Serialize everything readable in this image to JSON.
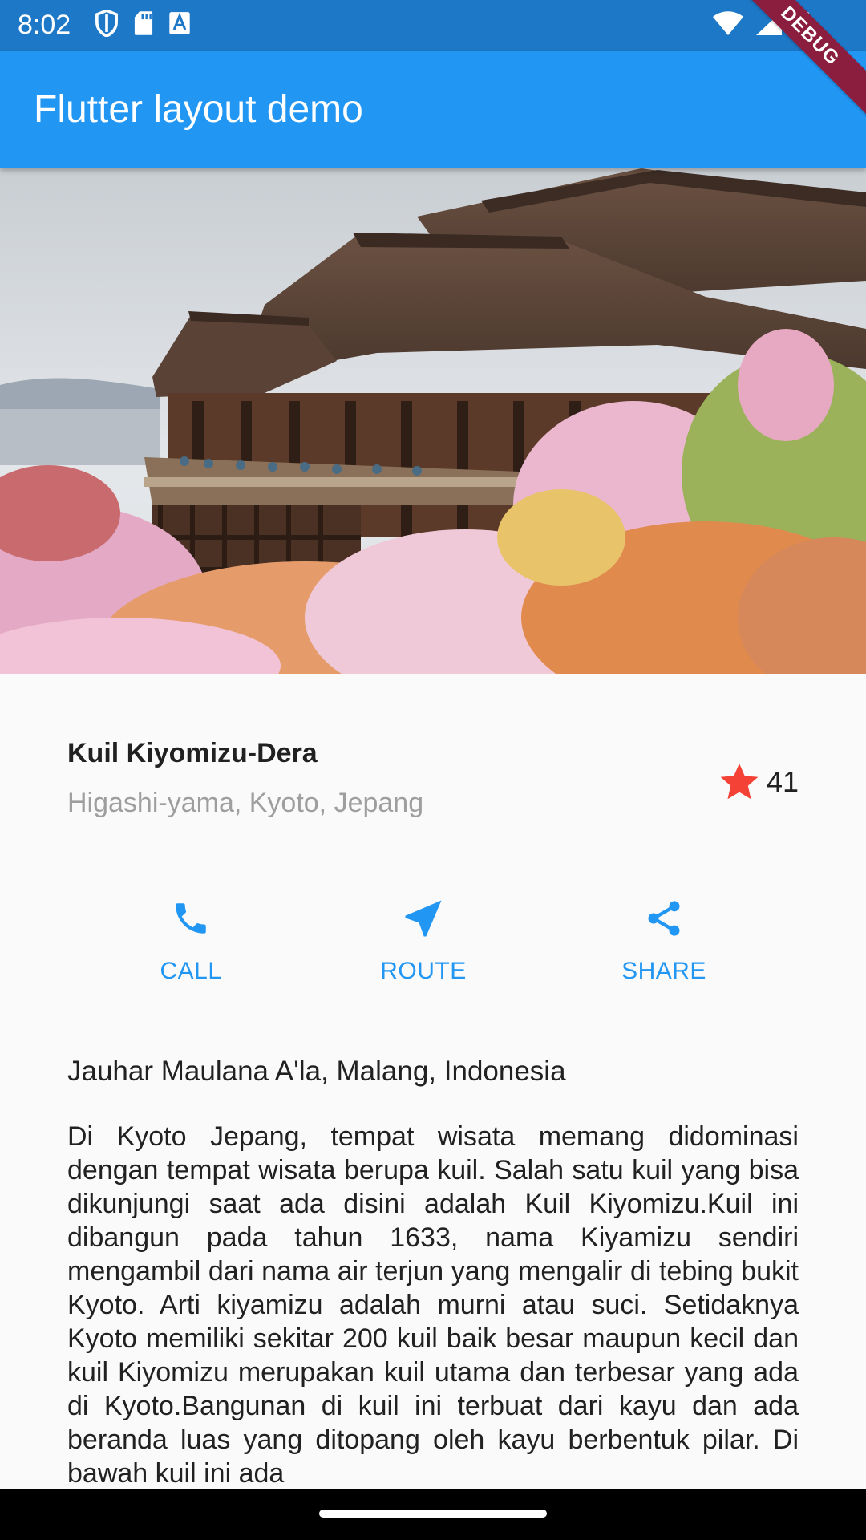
{
  "status_bar": {
    "time": "8:02",
    "left_icons": [
      "shield-icon",
      "sd-card-icon",
      "text-box-icon"
    ],
    "right_icons": [
      "wifi-icon",
      "signal-icon",
      "battery-icon"
    ]
  },
  "app_bar": {
    "title": "Flutter layout demo"
  },
  "debug_banner": "DEBUG",
  "place": {
    "name": "Kuil Kiyomizu-Dera",
    "location": "Higashi-yama, Kyoto, Jepang",
    "rating_count": "41",
    "star_color": "#F44336"
  },
  "actions": [
    {
      "label": "CALL",
      "icon": "phone-icon"
    },
    {
      "label": "ROUTE",
      "icon": "navigation-icon"
    },
    {
      "label": "SHARE",
      "icon": "share-icon"
    }
  ],
  "accent_color": "#2196F3",
  "author": "Jauhar Maulana A'la, Malang, Indonesia",
  "description": "Di Kyoto Jepang, tempat wisata memang didominasi dengan tempat wisata berupa kuil. Salah satu kuil yang bisa dikunjungi saat ada disini adalah Kuil Kiyomizu.Kuil ini dibangun pada tahun 1633, nama Kiyamizu sendiri mengambil dari nama air terjun yang mengalir di tebing bukit Kyoto. Arti kiyamizu adalah murni atau suci. Setidaknya Kyoto memiliki sekitar 200 kuil baik besar maupun kecil dan kuil Kiyomizu merupakan kuil utama dan terbesar yang ada di Kyoto.Bangunan di kuil ini terbuat dari kayu dan ada beranda luas yang ditopang oleh kayu berbentuk pilar. Di bawah kuil ini ada"
}
